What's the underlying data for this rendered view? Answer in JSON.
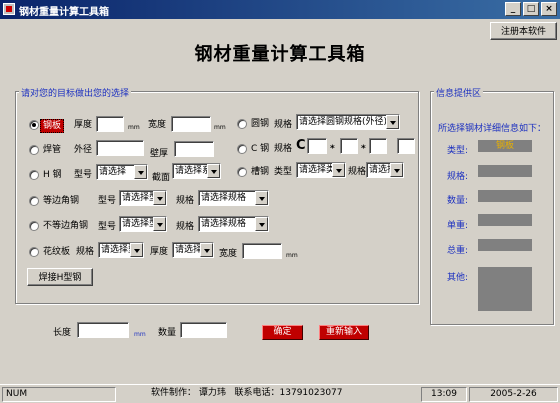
{
  "window": {
    "title": "钢材重量计算工具箱",
    "minimize": "_",
    "maximize": "□",
    "close": "×"
  },
  "toolbar": {
    "register_label": "注册本软件"
  },
  "main_title": "钢材重量计算工具箱",
  "select_group": {
    "legend": "请对您的目标做出您的选择",
    "steel_plate": {
      "label": "钢板",
      "thickness_label": "厚度",
      "thickness_value": "",
      "thickness_unit": "mm",
      "width_label": "宽度",
      "width_value": "",
      "width_unit": "mm"
    },
    "round_steel": {
      "label": "圆钢",
      "spec_label": "规格",
      "spec_value": "请选择圆钢规格(外径)"
    },
    "welded_pipe": {
      "label": "焊管",
      "outer_label": "外径",
      "outer_value": "",
      "wall_label": "壁厚",
      "wall_value": ""
    },
    "c_steel": {
      "label": "C 钢",
      "spec_label": "规格",
      "prefix": "C",
      "sep1": "*",
      "sep2": "*",
      "v1": "",
      "v2": "",
      "v3": "",
      "v4": ""
    },
    "h_steel": {
      "label": "H 钢",
      "model_label": "型号",
      "model_value": "请选择",
      "section_label": "截面",
      "section_value": "请选择系"
    },
    "channel_steel": {
      "label": "槽钢",
      "type_label": "类型",
      "type_value": "请选择类",
      "spec_label": "规格",
      "spec_value": "请选择"
    },
    "equal_angle": {
      "label": "等边角钢",
      "model_label": "型号",
      "model_value": "请选择型",
      "spec_label": "规格",
      "spec_value": "请选择规格"
    },
    "unequal_angle": {
      "label": "不等边角钢",
      "model_label": "型号",
      "model_value": "请选择型",
      "spec_label": "规格",
      "spec_value": "请选择规格"
    },
    "checker_plate": {
      "label": "花纹板",
      "spec_label": "规格",
      "spec_value": "请选择型",
      "thickness_label": "厚度",
      "thickness_value": "请选择",
      "width_label": "宽度",
      "width_value": "",
      "width_unit": "mm"
    },
    "welded_h_button": "焊接H型钢"
  },
  "info_group": {
    "legend": "信息提供区",
    "header": "所选择钢材详细信息如下：",
    "type_label": "类型:",
    "type_value": "钢板",
    "spec_label": "规格:",
    "spec_value": "",
    "qty_label": "数量:",
    "qty_value": "",
    "unit_price_label": "单重:",
    "unit_price_value": "",
    "total_label": "总重:",
    "total_value": "",
    "other_label": "其他:",
    "other_value": ""
  },
  "bottom": {
    "length_label": "长度",
    "length_value": "",
    "length_unit": "mm",
    "qty_label": "数量",
    "qty_value": "",
    "confirm_label": "确定",
    "reset_label": "重新输入"
  },
  "statusbar": {
    "num": "NUM",
    "author_label": "软件制作：",
    "author": "谭力玮",
    "phone_label": "联系电话：",
    "phone": "13791023077",
    "time": "13:09",
    "date": "2005-2-26"
  },
  "colors": {
    "title_start": "#0a246a",
    "title_end": "#3a6ea5",
    "accent_blue": "#1c30c0",
    "red_button": "#c00000",
    "info_box": "#808080",
    "highlight_text": "#e8b000"
  }
}
